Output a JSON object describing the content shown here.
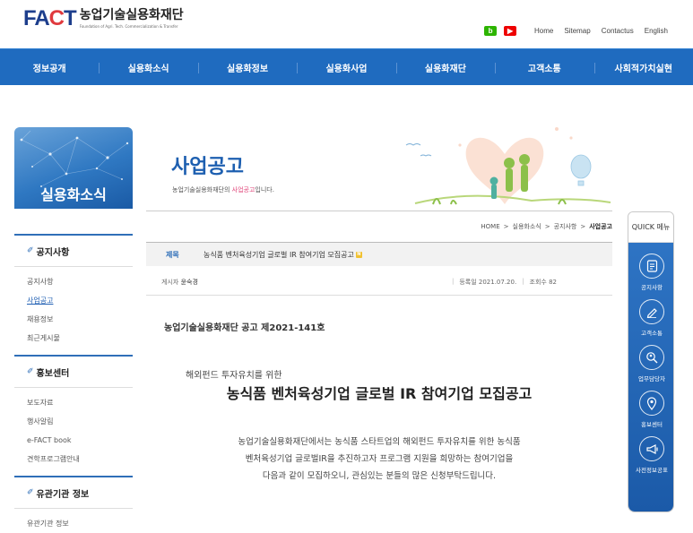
{
  "brand": {
    "mark_a": "FA",
    "mark_c": "C",
    "mark_t": "T",
    "name": "농업기술실용화재단",
    "en": "Foundation of Agri. Tech. Commercialization & Transfer"
  },
  "util": {
    "blog": "b",
    "youtube": "▶",
    "links": [
      "Home",
      "Sitemap",
      "Contactus",
      "English"
    ]
  },
  "gnb": [
    "정보공개",
    "실용화소식",
    "실용화정보",
    "실용화사업",
    "실용화재단",
    "고객소통",
    "사회적가치실현"
  ],
  "lnb": {
    "title": "실용화소식",
    "groups": [
      {
        "title": "공지사항",
        "items": [
          "공지사항",
          "사업공고",
          "채용정보",
          "최근게시물"
        ]
      },
      {
        "title": "홍보센터",
        "items": [
          "보도자료",
          "행사알림",
          "e-FACT book",
          "견학프로그램안내"
        ]
      },
      {
        "title": "유관기관 정보",
        "items": [
          "유관기관 정보"
        ]
      }
    ]
  },
  "page": {
    "title": "사업공고",
    "sub_pre": "농업기술실용화재단의 ",
    "sub_hl": "사업공고",
    "sub_post": "입니다."
  },
  "breadcrumb": [
    "HOME",
    ">",
    "실용화소식",
    ">",
    "공지사항",
    ">",
    "사업공고"
  ],
  "post": {
    "subject_label": "제목",
    "subject": "농식품 벤처육성기업 글로벌 IR 참여기업 모집공고",
    "new_badge": "N",
    "writer_label": "게시자",
    "writer": "윤숙경",
    "date": "등록일 2021.07.20.",
    "sep": "|",
    "views": "조회수 82"
  },
  "body": {
    "notice_no": "농업기술실용화재단 공고 제2021-141호",
    "small_title": "해외펀드 투자유치를 위한",
    "big_title": "농식품 벤처육성기업 글로벌 IR 참여기업 모집공고",
    "para": [
      "농업기술실용화재단에서는 농식품 스타트업의 해외펀드 투자유치를 위한 농식품",
      "벤처육성기업 글로벌IR을 추진하고자 프로그램 지원을 희망하는 참여기업을",
      "다음과 같이 모집하오니, 관심있는 분들의 많은 신청부탁드립니다."
    ]
  },
  "quick": {
    "title": "QUICK 메뉴",
    "items": [
      {
        "label": "공지사항",
        "icon": "document-icon"
      },
      {
        "label": "고객소통",
        "icon": "pencil-icon"
      },
      {
        "label": "업무담당자",
        "icon": "search-person-icon"
      },
      {
        "label": "홍보센터",
        "icon": "location-icon"
      },
      {
        "label": "사전정보공표",
        "icon": "megaphone-icon"
      }
    ]
  },
  "colors": {
    "primary": "#1f6bbf",
    "accent": "#e0457a",
    "badge": "#f1c232"
  }
}
